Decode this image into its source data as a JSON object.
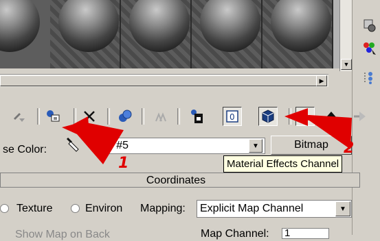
{
  "toolbar": {
    "buttons": [
      {
        "name": "get-material-icon"
      },
      {
        "name": "put-to-scene-icon"
      },
      {
        "name": "delete-icon"
      },
      {
        "name": "make-unique-icon"
      },
      {
        "name": "put-to-library-icon"
      },
      {
        "name": "material-id-icon"
      },
      {
        "name": "show-map-icon"
      },
      {
        "name": "material-effects-channel-icon"
      },
      {
        "name": "show-end-result-icon"
      },
      {
        "name": "go-parent-icon"
      },
      {
        "name": "go-forward-icon"
      }
    ]
  },
  "color_row": {
    "label": "se Color:",
    "map_value": "ap #5",
    "bitmap_label": "Bitmap"
  },
  "tooltip": "Material Effects Channel",
  "rollout": {
    "title": "Coordinates",
    "texture_label": "Texture",
    "environ_label": "Environ",
    "mapping_label": "Mapping:",
    "mapping_value": "Explicit Map Channel",
    "partial_left": "Show Map on Back",
    "map_channel_label": "Map Channel:",
    "map_channel_value": "1"
  },
  "annotations": {
    "arrow1_label": "1",
    "arrow2_label": "2",
    "arrow_color": "#e00000"
  }
}
